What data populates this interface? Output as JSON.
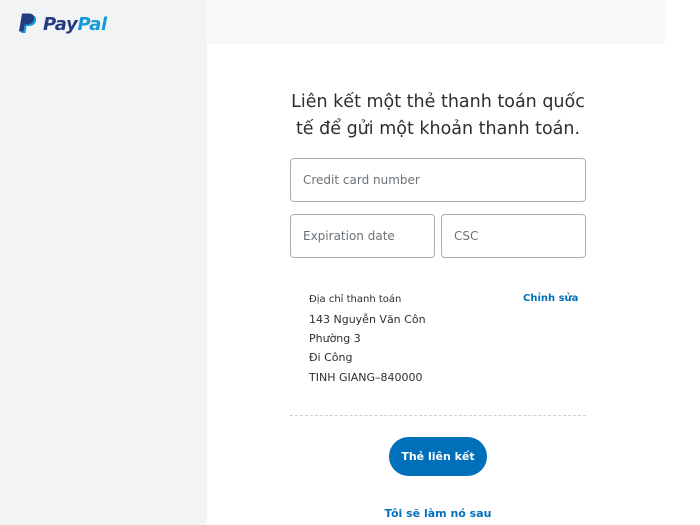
{
  "brand": {
    "name_part1": "Pay",
    "name_part2": "Pal",
    "color_dark": "#253b80",
    "color_light": "#179bd7"
  },
  "form": {
    "heading_line1": "Liên kết một thẻ thanh toán quốc",
    "heading_line2": "tế để gửi một khoản thanh toán.",
    "card_number_placeholder": "Credit card number",
    "expiration_placeholder": "Expiration date",
    "csc_placeholder": "CSC"
  },
  "billing": {
    "title": "Địa chỉ thanh toán",
    "edit_label": "Chỉnh sửa",
    "lines": [
      "143 Nguyễn Văn Côn",
      "Phường 3",
      "Đi Công",
      "TINH GIANG–840000"
    ]
  },
  "actions": {
    "link_card_label": "Thẻ liên kết",
    "later_label": "Tôi sẽ làm nó sau"
  },
  "colors": {
    "accent": "#0070ba",
    "sidebar_bg": "#f2f3f5",
    "text": "#2c2e2f"
  }
}
